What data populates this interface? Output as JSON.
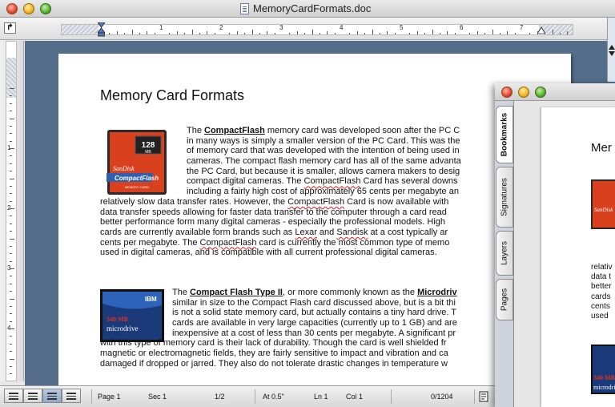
{
  "window": {
    "title": "MemoryCardFormats.doc"
  },
  "ruler": {
    "tab_selector": "↱",
    "numbers": [
      "1",
      "2",
      "3",
      "4",
      "5",
      "6",
      "7"
    ],
    "vertical_numbers": [
      "1",
      "2",
      "3",
      "4"
    ]
  },
  "document": {
    "heading": "Memory Card Formats",
    "para1": {
      "lines": [
        [
          "The ",
          {
            "b": "CompactFlash"
          },
          " memory card was developed soon after the PC C"
        ],
        [
          "in many ways is simply a smaller version of the PC Card. This was the"
        ],
        [
          "of memory card that was developed with the intention of being used in"
        ],
        [
          "cameras. The compact flash memory card has all of the same advanta"
        ],
        [
          "the PC Card, but because it is smaller, allows camera makers to desig"
        ],
        [
          "compact digital cameras. The ",
          {
            "s": "CompactFlash"
          },
          " Card has several downs"
        ],
        [
          "including a fairly high cost of approximately 65 cents per megabyte an"
        ],
        [
          "relatively slow data transfer rates. However, the ",
          {
            "s": "CompactFlash"
          },
          " Card is now available with"
        ],
        [
          "data transfer speeds allowing for faster data transfer to the computer through a card read"
        ],
        [
          "better performance form many digital cameras - especially the professional models. High"
        ],
        [
          "cards are currently available form brands such as ",
          {
            "s": "Lexar"
          },
          " and ",
          {
            "s": "Sandisk"
          },
          " at a cost typically ar"
        ],
        [
          "cents per megabyte. The ",
          {
            "s": "CompactFlash"
          },
          " card is currently the most common type of memo"
        ],
        [
          "used in digital cameras, and is compatible with all current professional digital cameras."
        ]
      ]
    },
    "para2": {
      "lines": [
        [
          "The ",
          {
            "b": "Compact Flash Type II"
          },
          ", or more commonly known as the ",
          {
            "b": "Microdriv"
          }
        ],
        [
          "similar in size to the Compact Flash card discussed above, but is a bit thi"
        ],
        [
          "is not a solid state memory card, but actually contains a tiny hard drive. T"
        ],
        [
          "cards are available in very large capacities (currently up to 1 GB) and are"
        ],
        [
          "inexpensive at a cost of less than 30 cents per megabyte. A significant pr"
        ],
        [
          "with this type of memory card is their lack of durability. Though the card is well shielded fr"
        ],
        [
          "magnetic or electromagnetic fields, they are fairly sensitive to impact and vibration and ca"
        ],
        [
          "damaged if dropped or jarred. They also do not tolerate drastic changes in temperature w"
        ]
      ]
    },
    "cf_image": {
      "capacity": "128",
      "unit": "MB",
      "brand": "SanDisk",
      "product": "CompactFlash",
      "footer": "MEMORY CARD"
    },
    "md_image": {
      "brand": "IBM",
      "capacity": "340 MB",
      "product": "microdrive"
    }
  },
  "statusbar": {
    "page": "Page 1",
    "sec": "Sec 1",
    "pages": "1/2",
    "at": "At 0.5\"",
    "ln": "Ln 1",
    "col": "Col 1",
    "words": "0/1204"
  },
  "palette": {
    "tabs": [
      "Bookmarks",
      "Signatures",
      "Layers",
      "Pages"
    ],
    "active_tab": "Bookmarks",
    "preview_heading": "Mer",
    "preview_lines": [
      "relativ",
      "data t",
      "better",
      "cards",
      "cents",
      "used"
    ]
  },
  "colors": {
    "canvas": "#536d8a",
    "spell_underline": "#d02020",
    "cf_red": "#d8401e",
    "md_blue": "#1a3a7a"
  }
}
